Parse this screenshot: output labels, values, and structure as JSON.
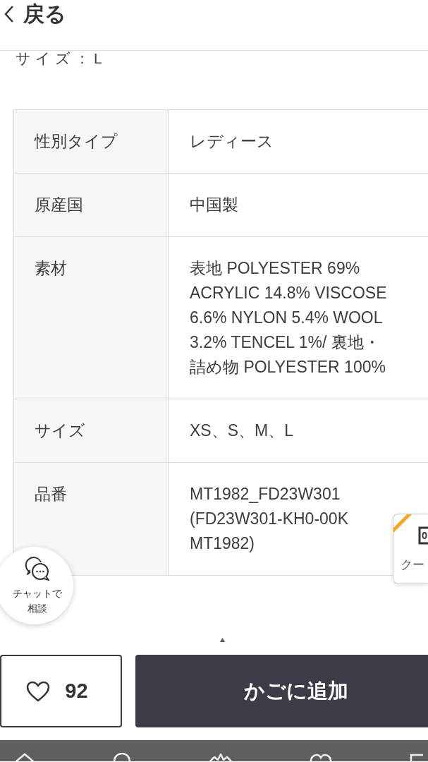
{
  "header": {
    "back_label": "戻る"
  },
  "previous_line": "サイズ：L",
  "spec_table": {
    "rows": [
      {
        "label": "性別タイプ",
        "value": "レディース"
      },
      {
        "label": "原産国",
        "value": "中国製"
      },
      {
        "label": "素材",
        "value": "表地 POLYESTER 69% ACRYLIC 14.8% VISCOSE 6.6% NYLON 5.4% WOOL 3.2% TENCEL 1%/ 裏地・詰め物 POLYESTER 100%"
      },
      {
        "label": "サイズ",
        "value": "XS、S、M、L"
      },
      {
        "label": "品番",
        "value": "MT1982_FD23W301 (FD23W301-KH0-00K MT1982)"
      }
    ]
  },
  "chat_button": {
    "label": "チャットで相談"
  },
  "coupon_tab": {
    "label": "クー"
  },
  "like_button": {
    "count": "92"
  },
  "cart_button": {
    "label": "かごに追加"
  }
}
